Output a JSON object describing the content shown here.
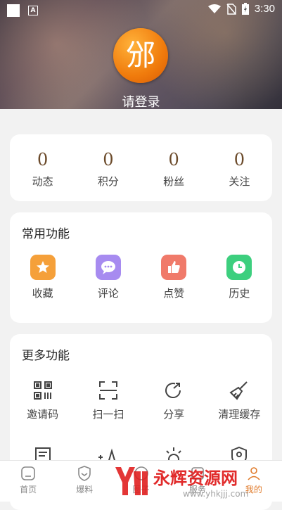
{
  "status_bar": {
    "time": "3:30"
  },
  "profile": {
    "avatar_glyph": "邠",
    "login_text": "请登录"
  },
  "stats": [
    {
      "value": "0",
      "label": "动态"
    },
    {
      "value": "0",
      "label": "积分"
    },
    {
      "value": "0",
      "label": "粉丝"
    },
    {
      "value": "0",
      "label": "关注"
    }
  ],
  "common": {
    "title": "常用功能",
    "items": [
      {
        "label": "收藏",
        "icon": "star-icon",
        "color": "#f5a03a"
      },
      {
        "label": "评论",
        "icon": "comment-icon",
        "color": "#a78bf0"
      },
      {
        "label": "点赞",
        "icon": "thumbs-up-icon",
        "color": "#f07a6a"
      },
      {
        "label": "历史",
        "icon": "clock-icon",
        "color": "#3dcf7e"
      }
    ]
  },
  "more": {
    "title": "更多功能",
    "items": [
      {
        "label": "邀请码",
        "icon": "qr-code-icon"
      },
      {
        "label": "扫一扫",
        "icon": "scan-icon"
      },
      {
        "label": "分享",
        "icon": "share-icon"
      },
      {
        "label": "清理缓存",
        "icon": "broom-icon"
      }
    ]
  },
  "tabs": [
    {
      "label": "首页",
      "icon": "home-icon"
    },
    {
      "label": "爆料",
      "icon": "shield-icon"
    },
    {
      "label": "圈子",
      "icon": "circle-icon"
    },
    {
      "label": "服务",
      "icon": "service-icon"
    },
    {
      "label": "我的",
      "icon": "user-icon"
    }
  ],
  "watermark": {
    "brand": "永辉资源网",
    "url": "www.yhkjjj.com"
  },
  "colors": {
    "accent": "#e07a2a",
    "stat_number": "#6b4a2a"
  }
}
